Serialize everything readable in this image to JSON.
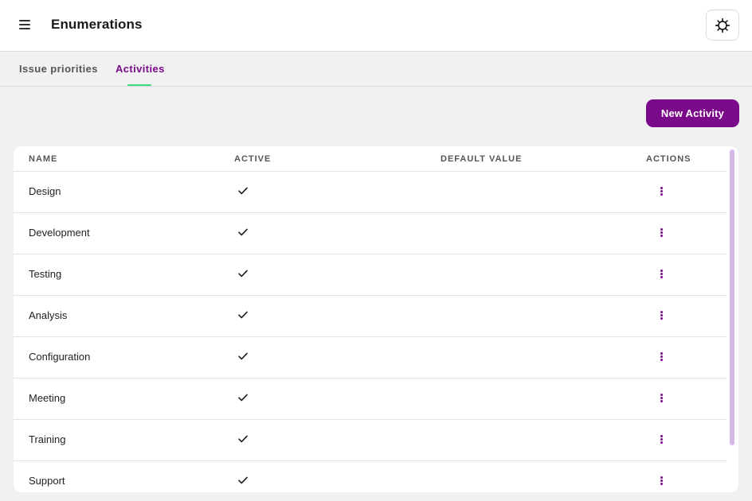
{
  "header": {
    "title": "Enumerations",
    "menu_icon": "hamburger-menu-icon",
    "settings_icon": "gear-icon"
  },
  "tabs": [
    {
      "label": "Issue priorities",
      "active": false
    },
    {
      "label": "Activities",
      "active": true
    }
  ],
  "toolbar": {
    "new_label": "New Activity"
  },
  "table": {
    "columns": [
      "NAME",
      "ACTIVE",
      "DEFAULT VALUE",
      "ACTIONS"
    ],
    "rows": [
      {
        "name": "Design",
        "active": true,
        "default": false
      },
      {
        "name": "Development",
        "active": true,
        "default": false
      },
      {
        "name": "Testing",
        "active": true,
        "default": false
      },
      {
        "name": "Analysis",
        "active": true,
        "default": false
      },
      {
        "name": "Configuration",
        "active": true,
        "default": false
      },
      {
        "name": "Meeting",
        "active": true,
        "default": false
      },
      {
        "name": "Training",
        "active": true,
        "default": false
      },
      {
        "name": "Support",
        "active": true,
        "default": false
      }
    ]
  },
  "colors": {
    "accent": "#7a0a8a",
    "tab_indicator": "#3ddc84",
    "scrollbar_thumb": "#d6b8e8"
  }
}
